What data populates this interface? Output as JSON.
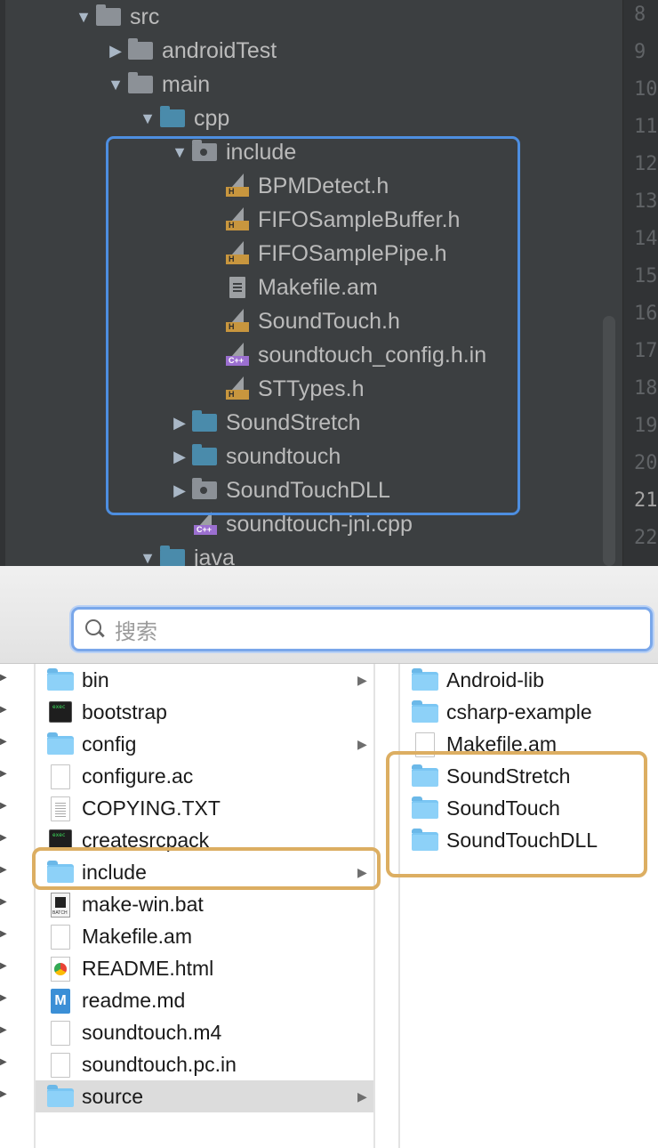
{
  "ide": {
    "line_numbers": [
      "8",
      "9",
      "10",
      "11",
      "12",
      "13",
      "14",
      "15",
      "16",
      "17",
      "18",
      "19",
      "20",
      "21",
      "22"
    ],
    "current_line": "21",
    "tree": [
      {
        "label": "src",
        "arrow": "open",
        "icon": "folder-gray-icon"
      },
      {
        "label": "androidTest",
        "arrow": "closed",
        "icon": "folder-gray-icon"
      },
      {
        "label": "main",
        "arrow": "open",
        "icon": "folder-gray-icon"
      },
      {
        "label": "cpp",
        "arrow": "open",
        "icon": "folder-blue-icon"
      },
      {
        "label": "include",
        "arrow": "open",
        "icon": "folder-dot-icon"
      },
      {
        "label": "BPMDetect.h",
        "arrow": "",
        "icon": "header-file-icon"
      },
      {
        "label": "FIFOSampleBuffer.h",
        "arrow": "",
        "icon": "header-file-icon"
      },
      {
        "label": "FIFOSamplePipe.h",
        "arrow": "",
        "icon": "header-file-icon"
      },
      {
        "label": "Makefile.am",
        "arrow": "",
        "icon": "text-file-icon"
      },
      {
        "label": "SoundTouch.h",
        "arrow": "",
        "icon": "header-file-icon"
      },
      {
        "label": "soundtouch_config.h.in",
        "arrow": "",
        "icon": "cpp-file-icon"
      },
      {
        "label": "STTypes.h",
        "arrow": "",
        "icon": "header-file-icon"
      },
      {
        "label": "SoundStretch",
        "arrow": "closed",
        "icon": "folder-blue-icon"
      },
      {
        "label": "soundtouch",
        "arrow": "closed",
        "icon": "folder-blue-icon"
      },
      {
        "label": "SoundTouchDLL",
        "arrow": "closed",
        "icon": "folder-dot-icon"
      },
      {
        "label": "soundtouch-jni.cpp",
        "arrow": "",
        "icon": "cpp-file-icon"
      },
      {
        "label": "java",
        "arrow": "open",
        "icon": "folder-blue-icon"
      }
    ],
    "icon_tags": {
      "header": "H",
      "cpp": "C++"
    }
  },
  "finder": {
    "search_placeholder": "搜索",
    "column1": [
      {
        "label": "bin",
        "icon": "folder-icon",
        "has_children": true
      },
      {
        "label": "bootstrap",
        "icon": "executable-icon",
        "has_children": false
      },
      {
        "label": "config",
        "icon": "folder-icon",
        "has_children": true
      },
      {
        "label": "configure.ac",
        "icon": "document-icon",
        "has_children": false
      },
      {
        "label": "COPYING.TXT",
        "icon": "text-document-icon",
        "has_children": false
      },
      {
        "label": "createsrcpack",
        "icon": "executable-icon",
        "has_children": false
      },
      {
        "label": "include",
        "icon": "folder-icon",
        "has_children": true
      },
      {
        "label": "make-win.bat",
        "icon": "batch-file-icon",
        "has_children": false
      },
      {
        "label": "Makefile.am",
        "icon": "document-icon",
        "has_children": false
      },
      {
        "label": "README.html",
        "icon": "chrome-html-icon",
        "has_children": false
      },
      {
        "label": "readme.md",
        "icon": "markdown-icon",
        "has_children": false
      },
      {
        "label": "soundtouch.m4",
        "icon": "document-icon",
        "has_children": false
      },
      {
        "label": "soundtouch.pc.in",
        "icon": "document-icon",
        "has_children": false
      },
      {
        "label": "source",
        "icon": "folder-icon",
        "has_children": true,
        "selected": true
      }
    ],
    "column2": [
      {
        "label": "Android-lib",
        "icon": "folder-icon"
      },
      {
        "label": "csharp-example",
        "icon": "folder-icon"
      },
      {
        "label": "Makefile.am",
        "icon": "document-icon"
      },
      {
        "label": "SoundStretch",
        "icon": "folder-icon"
      },
      {
        "label": "SoundTouch",
        "icon": "folder-icon"
      },
      {
        "label": "SoundTouchDLL",
        "icon": "folder-icon"
      }
    ],
    "chevron": "▶"
  },
  "colors": {
    "ide_background": "#3c3f41",
    "highlight_blue": "#4d8ee0",
    "highlight_orange": "#dcae62",
    "selection_gray": "#dcdcdc"
  }
}
